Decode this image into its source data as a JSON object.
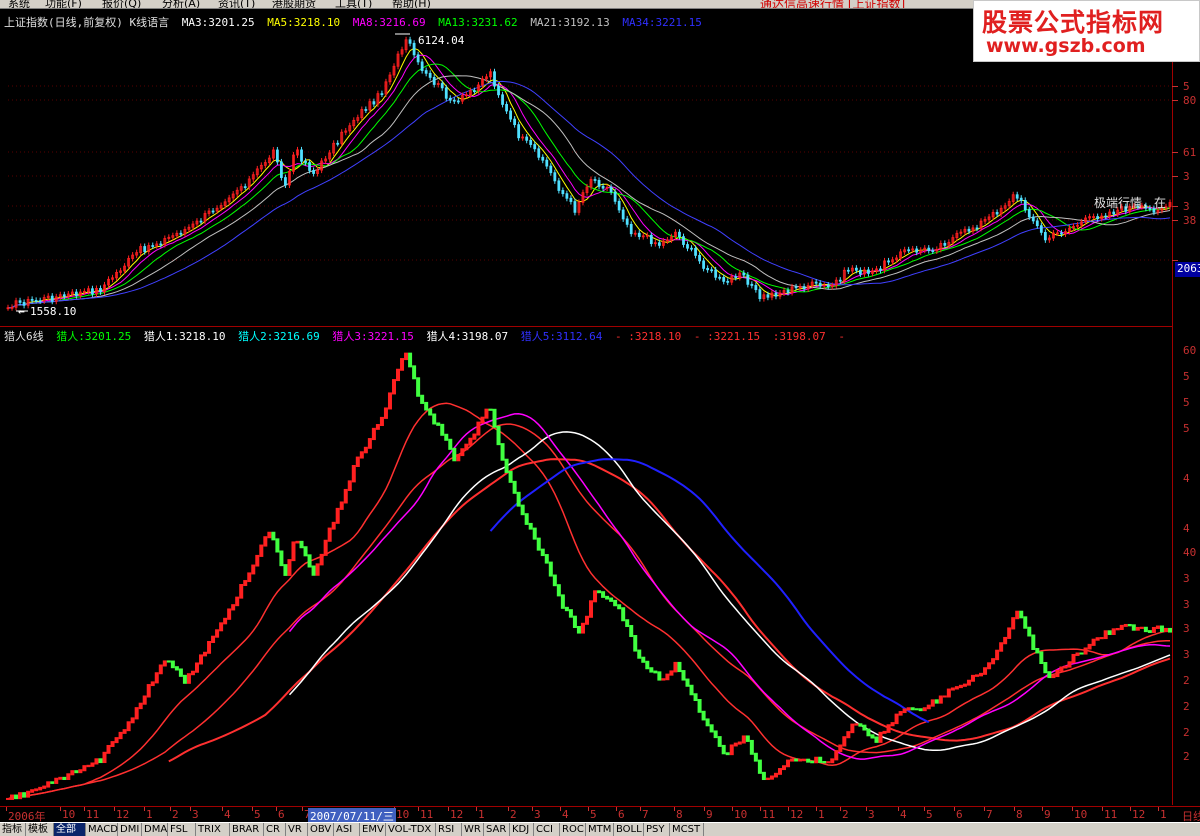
{
  "menu": {
    "items": [
      "系统",
      "功能(F)",
      "报价(Q)",
      "分析(A)",
      "资讯(T)",
      "港股期货",
      "工具(T)",
      "帮助(H)"
    ],
    "promo": "通达信高速行情 [上证指数]"
  },
  "watermark": {
    "line1": "股票公式指标网",
    "line2": "www.gszb.com"
  },
  "top_panel": {
    "title": "上证指数(日线,前复权) K线语言",
    "ma": [
      {
        "label": "MA3:3201.25",
        "color": "#ffffff"
      },
      {
        "label": "MA5:3218.10",
        "color": "#ffff00"
      },
      {
        "label": "MA8:3216.69",
        "color": "#ff00ff"
      },
      {
        "label": "MA13:3231.62",
        "color": "#00ff00"
      },
      {
        "label": "MA21:3192.13",
        "color": "#c0c0c0"
      },
      {
        "label": "MA34:3221.15",
        "color": "#3030ff"
      }
    ],
    "high_label": "6124.04",
    "low_label": "1558.10",
    "last_price": "2063",
    "side_text": "极端行情，在",
    "y_ticks": [
      "5",
      "80",
      "61",
      "3",
      "3",
      "38"
    ]
  },
  "bottom_panel": {
    "title": "猎人6线",
    "values": [
      {
        "label": "猎人:3201.25",
        "color": "#00ff00"
      },
      {
        "label": "猎人1:3218.10",
        "color": "#ffffff"
      },
      {
        "label": "猎人2:3216.69",
        "color": "#00ffff"
      },
      {
        "label": "猎人3:3221.15",
        "color": "#ff00ff"
      },
      {
        "label": "猎人4:3198.07",
        "color": "#ffffff"
      },
      {
        "label": "猎人5:3112.64",
        "color": "#3030ff"
      },
      {
        "label": "- :3218.10",
        "color": "#ff3030"
      },
      {
        "label": "- :3221.15",
        "color": "#ff3030"
      },
      {
        "label": ":3198.07",
        "color": "#ff3030"
      },
      {
        "label": "-",
        "color": "#ff3030"
      }
    ],
    "y_ticks": [
      "60",
      "5",
      "5",
      "5",
      "4",
      "4",
      "40",
      "3",
      "3",
      "3",
      "3",
      "2",
      "2",
      "2",
      "2"
    ]
  },
  "x_axis": {
    "labels": [
      "2006年",
      "10",
      "11",
      "12",
      "1",
      "2",
      "3",
      "4",
      "5",
      "6",
      "7",
      "10",
      "11",
      "12",
      "1",
      "2",
      "3",
      "4",
      "5",
      "6",
      "7",
      "8",
      "9",
      "10",
      "11",
      "12",
      "1",
      "2",
      "3",
      "4",
      "5",
      "6",
      "7",
      "8",
      "9",
      "10",
      "11",
      "12",
      "1"
    ],
    "cursor_date": "2007/07/11/三",
    "right_label": "日线"
  },
  "tabs": [
    "指标",
    "模板",
    "全部",
    "MACD",
    "DMI",
    "DMA",
    "FSL",
    "TRIX",
    "BRAR",
    "CR",
    "VR",
    "OBV",
    "ASI",
    "EMV",
    "VOL-TDX",
    "RSI",
    "WR",
    "SAR",
    "KDJ",
    "CCI",
    "ROC",
    "MTM",
    "BOLL",
    "PSY",
    "MCST"
  ],
  "active_tab": "全部",
  "colors": {
    "up": "#ff2020",
    "down": "#50e0ff",
    "axis": "#c83030",
    "grid": "#5a0000"
  }
}
